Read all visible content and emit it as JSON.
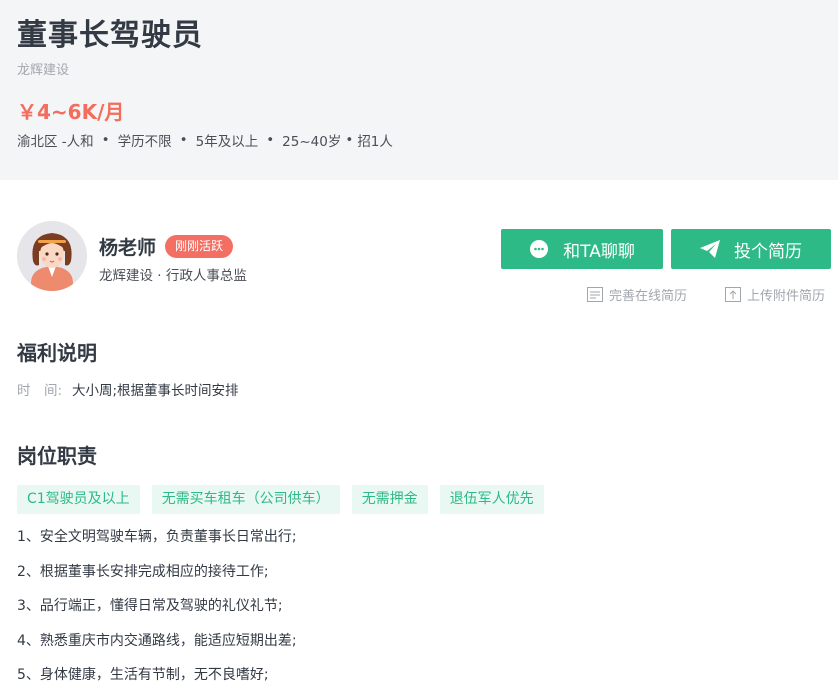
{
  "job": {
    "title": "董事长驾驶员",
    "company": "龙辉建设",
    "salary": "￥4~6K/月",
    "location": "渝北区 -人和",
    "education": "学历不限",
    "experience": "5年及以上",
    "age": "25~40岁",
    "headcount": "招1人",
    "separator": "•"
  },
  "recruiter": {
    "name": "杨老师",
    "badge": "刚刚活跃",
    "subtitle": "龙辉建设 · 行政人事总监",
    "avatar_icon": "woman-avatar-icon"
  },
  "actions": {
    "chat_label": "和TA聊聊",
    "apply_label": "投个简历",
    "online_resume_label": "完善在线简历",
    "upload_resume_label": "上传附件简历"
  },
  "benefits": {
    "title": "福利说明",
    "time_label": "时　间:",
    "time_value": "大小周;根据董事长时间安排"
  },
  "duties": {
    "title": "岗位职责",
    "tags": [
      "C1驾驶员及以上",
      "无需买车租车（公司供车）",
      "无需押金",
      "退伍军人优先"
    ],
    "items": [
      "1、安全文明驾驶车辆，负责董事长日常出行;",
      "2、根据董事长安排完成相应的接待工作;",
      "3、品行端正，懂得日常及驾驶的礼仪礼节;",
      "4、熟悉重庆市内交通路线，能适应短期出差;",
      "5、身体健康，生活有节制，无不良嗜好;"
    ]
  },
  "colors": {
    "accent_green": "#2dba87",
    "salary_red": "#f26d5b",
    "badge_red": "#f46f63",
    "tag_bg": "#e9f8f2"
  }
}
